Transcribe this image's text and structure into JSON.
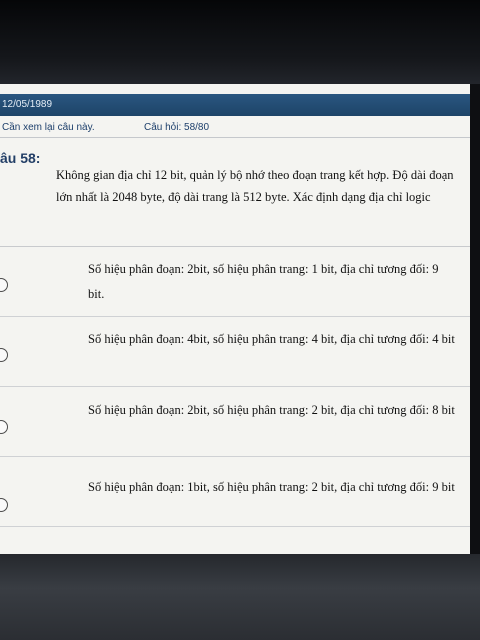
{
  "header": {
    "date": "12/05/1989",
    "review_link": "Cần xem lại câu này.",
    "progress": "Câu hỏi: 58/80"
  },
  "question": {
    "number": "âu 58:",
    "text": "Không gian địa chỉ 12 bit, quản lý bộ nhớ theo đoạn trang kết hợp. Độ dài đoạn lớn nhất là 2048 byte, độ dài trang là 512 byte. Xác định dạng địa chỉ logic"
  },
  "options": [
    {
      "text": "Số hiệu phân đoạn: 2bit, số hiệu phân trang: 1 bit, địa chỉ tương đối: 9 bit."
    },
    {
      "text": "Số hiệu phân đoạn: 4bit, số hiệu phân trang: 4 bit, địa chỉ tương đối: 4 bit"
    },
    {
      "text": "Số hiệu phân đoạn: 2bit, số hiệu phân trang: 2 bit, địa chỉ tương đối: 8 bit"
    },
    {
      "text": "Số hiệu phân đoạn: 1bit, số hiệu phân trang: 2 bit, địa chỉ tương đối: 9 bit"
    }
  ],
  "colors": {
    "header_bar": "#1d4468",
    "accent_text": "#223e66",
    "page_bg": "#f4f4f1"
  }
}
